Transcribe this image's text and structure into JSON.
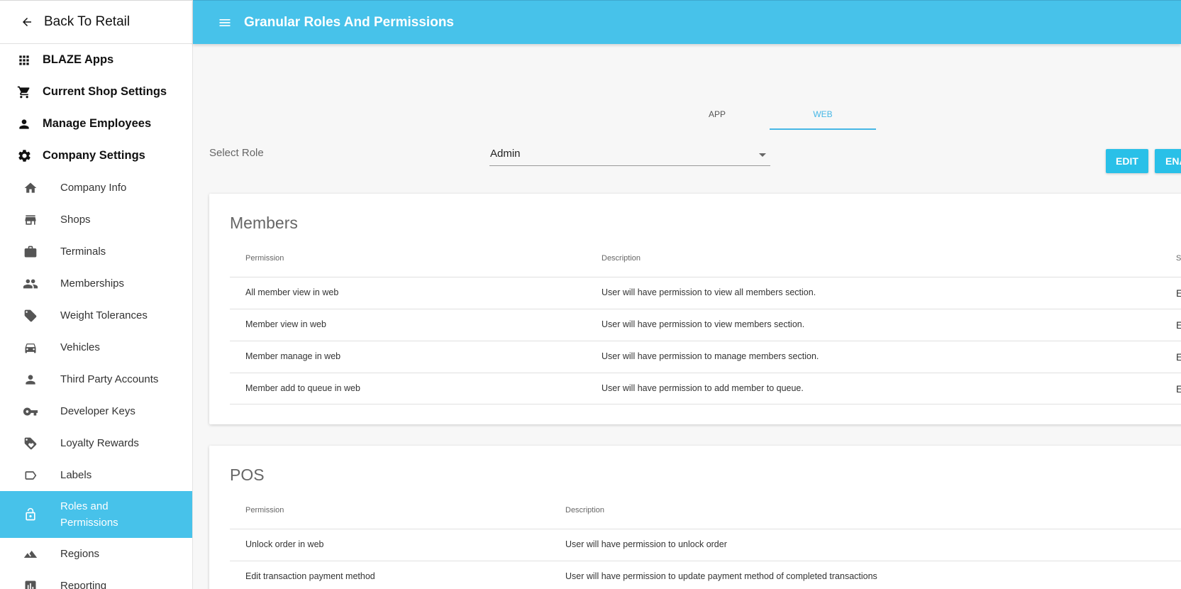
{
  "sidebar": {
    "back_label": "Back To Retail",
    "top_items": [
      {
        "label": "BLAZE Apps",
        "icon": "apps-grid-icon"
      },
      {
        "label": "Current Shop Settings",
        "icon": "shopping-cart-icon"
      },
      {
        "label": "Manage Employees",
        "icon": "person-icon"
      },
      {
        "label": "Company Settings",
        "icon": "gear-icon"
      }
    ],
    "sub_items": [
      {
        "label": "Company Info",
        "icon": "home-icon"
      },
      {
        "label": "Shops",
        "icon": "store-icon"
      },
      {
        "label": "Terminals",
        "icon": "briefcase-icon"
      },
      {
        "label": "Memberships",
        "icon": "people-icon"
      },
      {
        "label": "Weight Tolerances",
        "icon": "tag-icon"
      },
      {
        "label": "Vehicles",
        "icon": "car-icon"
      },
      {
        "label": "Third Party Accounts",
        "icon": "person-icon"
      },
      {
        "label": "Developer Keys",
        "icon": "key-icon"
      },
      {
        "label": "Loyalty Rewards",
        "icon": "loyalty-tag-icon"
      },
      {
        "label": "Labels",
        "icon": "label-icon"
      },
      {
        "label": "Roles and Permissions",
        "icon": "lock-icon",
        "active": true
      },
      {
        "label": "Regions",
        "icon": "terrain-icon"
      },
      {
        "label": "Reporting",
        "icon": "chart-icon"
      }
    ]
  },
  "header": {
    "title": "Granular Roles And Permissions"
  },
  "tabs": [
    {
      "label": "APP"
    },
    {
      "label": "WEB",
      "active": true
    }
  ],
  "role_select": {
    "label": "Select Role",
    "value": "Admin"
  },
  "buttons": {
    "edit": "EDIT",
    "enable": "ENA"
  },
  "members": {
    "title": "Members",
    "headers": {
      "permission": "Permission",
      "description": "Description",
      "status": "S"
    },
    "rows": [
      {
        "permission": "All member view in web",
        "description": "User will have permission to view all members section.",
        "status": "E"
      },
      {
        "permission": "Member view in web",
        "description": "User will have permission to view members section.",
        "status": "E"
      },
      {
        "permission": "Member manage in web",
        "description": "User will have permission to manage members section.",
        "status": "E"
      },
      {
        "permission": "Member add to queue in web",
        "description": "User will have permission to add member to queue.",
        "status": "E"
      }
    ]
  },
  "pos": {
    "title": "POS",
    "headers": {
      "permission": "Permission",
      "description": "Description"
    },
    "rows": [
      {
        "permission": "Unlock order in web",
        "description": "User will have permission to unlock order"
      },
      {
        "permission": "Edit transaction payment method",
        "description": "User will have permission to update payment method of completed transactions"
      }
    ]
  },
  "colors": {
    "accent": "#47c2ea",
    "button": "#29c0e8"
  }
}
